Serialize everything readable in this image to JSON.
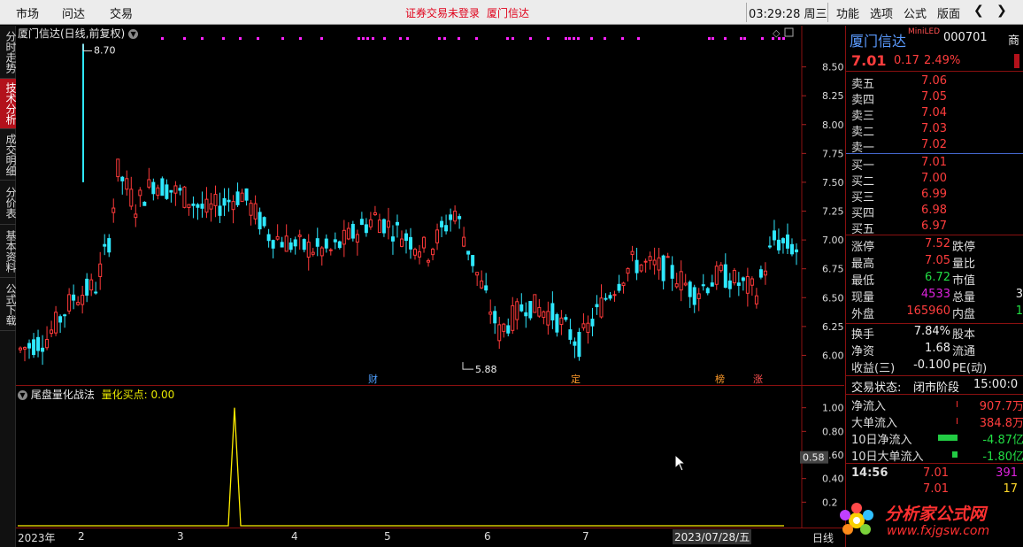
{
  "menu": {
    "market": "市场",
    "ask": "问达",
    "trade": "交易",
    "notice_login": "证券交易未登录",
    "notice_stock": "厦门信达",
    "clock": "03:29:28 周三",
    "function": "功能",
    "options": "选项",
    "formula": "公式",
    "layout": "版面"
  },
  "left_tabs": [
    "分时走势",
    "技术分析",
    "成交明细",
    "分价表",
    "基本资料",
    "公式下载"
  ],
  "main_chart": {
    "title": "厦门信达(日线,前复权)",
    "high_label": "8.70",
    "low_label": "5.88",
    "y_ticks": [
      "8.50",
      "8.25",
      "8.00",
      "7.75",
      "7.50",
      "7.25",
      "7.00",
      "6.75",
      "6.50",
      "6.25",
      "6.00"
    ],
    "event_markers": [
      {
        "text": "财",
        "color": "#4fa0ff"
      },
      {
        "text": "定",
        "color": "#ff9b2a"
      },
      {
        "text": "榜",
        "color": "#ff9b2a"
      },
      {
        "text": "涨",
        "color": "#ff5050"
      }
    ]
  },
  "indicator": {
    "name": "尾盘量化战法",
    "label": "量化买点: 0.00",
    "current_value": "0.58",
    "y_ticks": [
      "1.00",
      "0.80",
      "0.60",
      "0.40",
      "0.2"
    ]
  },
  "time_axis": {
    "labels": [
      "2023年",
      "2",
      "3",
      "4",
      "5",
      "6",
      "7"
    ],
    "current_date": "2023/07/28/五",
    "period": "日线"
  },
  "quote": {
    "name": "厦门信达",
    "tag": "MiniLED",
    "code": "000701",
    "extra": "商",
    "price": "7.01",
    "change": "0.17",
    "change_pct": "2.49%",
    "asks": [
      {
        "label": "卖五",
        "price": "7.06"
      },
      {
        "label": "卖四",
        "price": "7.05"
      },
      {
        "label": "卖三",
        "price": "7.04"
      },
      {
        "label": "卖二",
        "price": "7.03"
      },
      {
        "label": "卖一",
        "price": "7.02"
      }
    ],
    "bids": [
      {
        "label": "买一",
        "price": "7.01"
      },
      {
        "label": "买二",
        "price": "7.00"
      },
      {
        "label": "买三",
        "price": "6.99"
      },
      {
        "label": "买四",
        "price": "6.98"
      },
      {
        "label": "买五",
        "price": "6.97"
      }
    ],
    "stats": [
      {
        "l1": "涨停",
        "v1": "7.52",
        "c1": "red",
        "l2": "跌停",
        "v2": "",
        "c2": "green"
      },
      {
        "l1": "最高",
        "v1": "7.05",
        "c1": "red",
        "l2": "量比",
        "v2": "",
        "c2": "white"
      },
      {
        "l1": "最低",
        "v1": "6.72",
        "c1": "green",
        "l2": "市值",
        "v2": "",
        "c2": "white"
      },
      {
        "l1": "现量",
        "v1": "4533",
        "c1": "purple",
        "l2": "总量",
        "v2": "3",
        "c2": "white"
      },
      {
        "l1": "外盘",
        "v1": "165960",
        "c1": "red",
        "l2": "内盘",
        "v2": "1",
        "c2": "green"
      }
    ],
    "stats2": [
      {
        "l1": "换手",
        "v1": "7.84%",
        "c1": "white",
        "l2": "股本"
      },
      {
        "l1": "净资",
        "v1": "1.68",
        "c1": "white",
        "l2": "流通"
      },
      {
        "l1": "收益(三)",
        "v1": "-0.100",
        "c1": "white",
        "l2": "PE(动)"
      }
    ],
    "status_label": "交易状态:",
    "status_value": "闭市阶段",
    "status_time": "15:00:0",
    "flows": [
      {
        "label": "净流入",
        "value": "907.7万",
        "color": "red",
        "bar": 0
      },
      {
        "label": "大单流入",
        "value": "384.8万",
        "color": "red",
        "bar": 0
      },
      {
        "label": "10日净流入",
        "value": "-4.87亿",
        "color": "green",
        "bar": 22
      },
      {
        "label": "10日大单流入",
        "value": "-1.80亿",
        "color": "green",
        "bar": 6
      }
    ],
    "ticks": [
      {
        "time": "14:56",
        "price": "7.01",
        "vol": "391",
        "vcolor": "purple"
      },
      {
        "time": "",
        "price": "7.01",
        "vol": "17",
        "vcolor": "yellow"
      }
    ]
  },
  "logo": {
    "title": "分析家公式网",
    "url": "www.fxjgsw.com"
  }
}
